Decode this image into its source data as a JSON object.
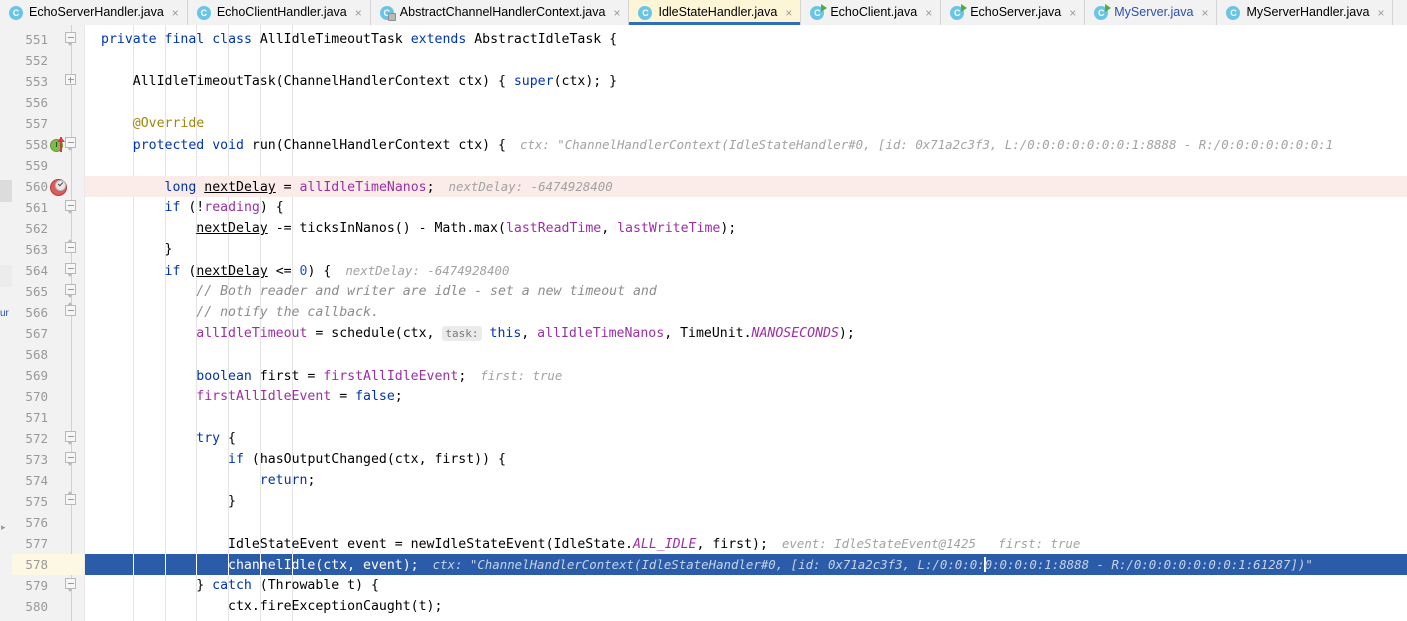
{
  "tabs": [
    {
      "label": "EchoServerHandler.java",
      "icon": "java-class-icon",
      "active": false,
      "closable": true,
      "style": "class"
    },
    {
      "label": "EchoClientHandler.java",
      "icon": "java-class-icon",
      "active": false,
      "closable": true,
      "style": "class"
    },
    {
      "label": "AbstractChannelHandlerContext.java",
      "icon": "java-class-readonly-icon",
      "active": false,
      "closable": true,
      "style": "readonly"
    },
    {
      "label": "IdleStateHandler.java",
      "icon": "java-class-icon",
      "active": true,
      "closable": true,
      "style": "class"
    },
    {
      "label": "EchoClient.java",
      "icon": "java-runnable-class-icon",
      "active": false,
      "closable": true,
      "style": "runnable"
    },
    {
      "label": "EchoServer.java",
      "icon": "java-runnable-class-icon",
      "active": false,
      "closable": true,
      "style": "runnable"
    },
    {
      "label": "MyServer.java",
      "icon": "java-runnable-class-icon",
      "active": false,
      "closable": true,
      "style": "runnable-blue"
    },
    {
      "label": "MyServerHandler.java",
      "icon": "java-class-icon",
      "active": false,
      "closable": true,
      "style": "class"
    }
  ],
  "rail": {
    "label": "ur"
  },
  "editor": {
    "current_line": 578,
    "breakpoint_line": 560,
    "impl_marker_line": 558,
    "selected_line": 578,
    "lines": [
      {
        "n": "551",
        "fold": "collapse",
        "text": "private final class AllIdleTimeoutTask extends AbstractIdleTask {"
      },
      {
        "n": "552",
        "fold": "",
        "text": ""
      },
      {
        "n": "553",
        "fold": "expand",
        "text": "    AllIdleTimeoutTask(ChannelHandlerContext ctx) { super(ctx); }"
      },
      {
        "n": "556",
        "fold": "",
        "text": ""
      },
      {
        "n": "557",
        "fold": "",
        "text": "    @Override"
      },
      {
        "n": "558",
        "fold": "collapse",
        "text": "    protected void run(ChannelHandlerContext ctx) {",
        "hint": "ctx: \"ChannelHandlerContext(IdleStateHandler#0, [id: 0x71a2c3f3, L:/0:0:0:0:0:0:0:1:8888 - R:/0:0:0:0:0:0:0:1"
      },
      {
        "n": "559",
        "fold": "",
        "text": ""
      },
      {
        "n": "560",
        "fold": "",
        "text": "        long nextDelay = allIdleTimeNanos;",
        "hint": "nextDelay: -6474928400"
      },
      {
        "n": "561",
        "fold": "collapse",
        "text": "        if (!reading) {"
      },
      {
        "n": "562",
        "fold": "",
        "text": "            nextDelay -= ticksInNanos() - Math.max(lastReadTime, lastWriteTime);"
      },
      {
        "n": "563",
        "fold": "end",
        "text": "        }"
      },
      {
        "n": "564",
        "fold": "collapse",
        "text": "        if (nextDelay <= 0) {",
        "hint": "nextDelay: -6474928400"
      },
      {
        "n": "565",
        "fold": "collapse",
        "text": "            // Both reader and writer are idle - set a new timeout and"
      },
      {
        "n": "566",
        "fold": "end",
        "text": "            // notify the callback."
      },
      {
        "n": "567",
        "fold": "",
        "text": "            allIdleTimeout = schedule(ctx, task: this, allIdleTimeNanos, TimeUnit.NANOSECONDS);"
      },
      {
        "n": "568",
        "fold": "",
        "text": ""
      },
      {
        "n": "569",
        "fold": "",
        "text": "            boolean first = firstAllIdleEvent;",
        "hint": "first: true"
      },
      {
        "n": "570",
        "fold": "",
        "text": "            firstAllIdleEvent = false;"
      },
      {
        "n": "571",
        "fold": "",
        "text": ""
      },
      {
        "n": "572",
        "fold": "collapse",
        "text": "            try {"
      },
      {
        "n": "573",
        "fold": "collapse",
        "text": "                if (hasOutputChanged(ctx, first)) {"
      },
      {
        "n": "574",
        "fold": "",
        "text": "                    return;"
      },
      {
        "n": "575",
        "fold": "end",
        "text": "                }"
      },
      {
        "n": "576",
        "fold": "",
        "text": ""
      },
      {
        "n": "577",
        "fold": "",
        "text": "                IdleStateEvent event = newIdleStateEvent(IdleState.ALL_IDLE, first);",
        "hint": "event: IdleStateEvent@1425   first: true"
      },
      {
        "n": "578",
        "fold": "",
        "text": "                channelIdle(ctx, event);",
        "hint": "ctx: \"ChannelHandlerContext(IdleStateHandler#0, [id: 0x71a2c3f3, L:/0:0:0:0:0:0:0:1:8888 - R:/0:0:0:0:0:0:0:1:61287])\""
      },
      {
        "n": "579",
        "fold": "collapse",
        "text": "            } catch (Throwable t) {"
      },
      {
        "n": "580",
        "fold": "",
        "text": "                ctx.fireExceptionCaught(t);"
      }
    ]
  },
  "colors": {
    "keyword": "#0033b3",
    "field": "#9c2fa5",
    "comment": "#8c8c8c",
    "annotation": "#9e880d",
    "number": "#1750eb",
    "inline_hint": "#a2a2a2",
    "selection": "#2a5caa",
    "current_line": "#fdf8e3",
    "breakpoint_line": "#fbece9",
    "active_tab": "#fdf6d6",
    "tab_underline": "#2f6fb5"
  }
}
